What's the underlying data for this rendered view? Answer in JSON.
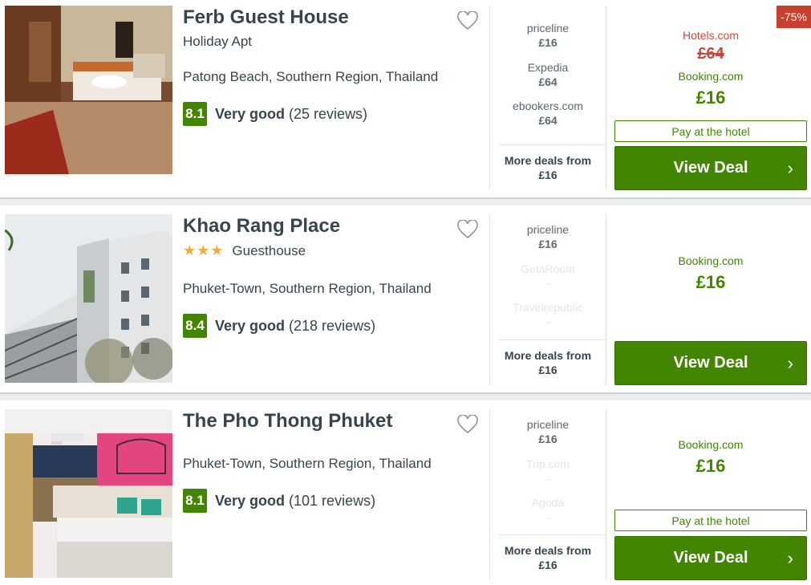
{
  "colors": {
    "accent": "#428500",
    "discount": "#c94a3d",
    "star": "#f6ab3f"
  },
  "hotels": [
    {
      "name": "Ferb Guest House",
      "subtype": "Holiday Apt",
      "stars": 0,
      "location": "Patong Beach, Southern Region, Thailand",
      "score": "8.1",
      "rating_word": "Very good",
      "reviews": "(25 reviews)",
      "deals": [
        {
          "site": "priceline",
          "price": "£16"
        },
        {
          "site": "Expedia",
          "price": "£64"
        },
        {
          "site": "ebookers.com",
          "price": "£64"
        }
      ],
      "more_label": "More deals from",
      "more_price": "£16",
      "discount_badge": "-75%",
      "struck_site": "Hotels.com",
      "struck_price": "£64",
      "best_site": "Booking.com",
      "best_price": "£16",
      "pay_label": "Pay at the hotel",
      "view_label": "View Deal"
    },
    {
      "name": "Khao Rang Place",
      "subtype": "Guesthouse",
      "stars": 3,
      "star_glyphs": "★★★",
      "location": "Phuket-Town, Southern Region, Thailand",
      "score": "8.4",
      "rating_word": "Very good",
      "reviews": "(218 reviews)",
      "deals": [
        {
          "site": "priceline",
          "price": "£16"
        },
        {
          "site": "GetaRoom",
          "price": "-"
        },
        {
          "site": "Travelrepublic",
          "price": "-"
        }
      ],
      "more_label": "More deals from",
      "more_price": "£16",
      "best_site": "Booking.com",
      "best_price": "£16",
      "view_label": "View Deal"
    },
    {
      "name": "The Pho Thong Phuket",
      "location": "Phuket-Town, Southern Region, Thailand",
      "score": "8.1",
      "rating_word": "Very good",
      "reviews": "(101 reviews)",
      "deals": [
        {
          "site": "priceline",
          "price": "£16"
        },
        {
          "site": "Trip.com",
          "price": "-"
        },
        {
          "site": "Agoda",
          "price": "-"
        }
      ],
      "more_label": "More deals from",
      "more_price": "£16",
      "best_site": "Booking.com",
      "best_price": "£16",
      "pay_label": "Pay at the hotel",
      "view_label": "View Deal"
    }
  ]
}
